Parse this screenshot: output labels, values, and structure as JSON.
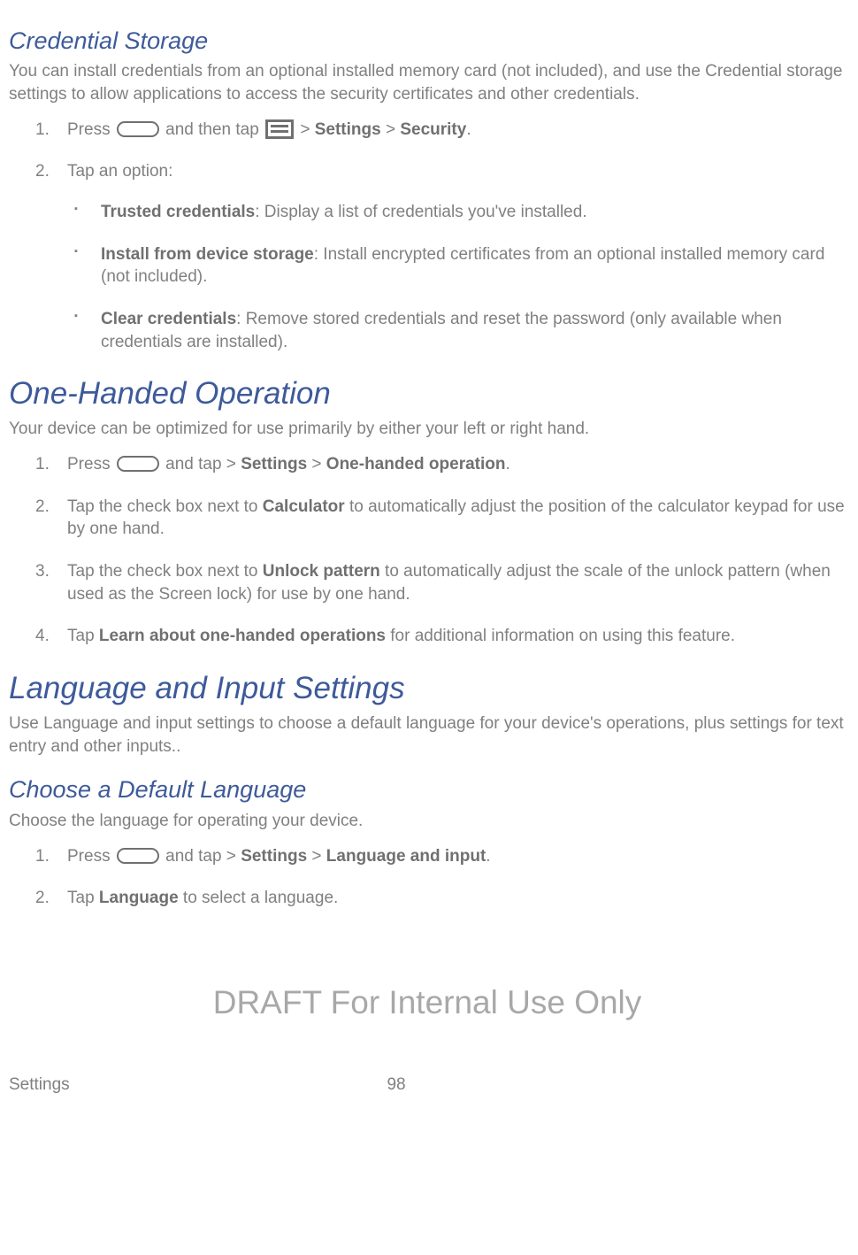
{
  "sec1": {
    "title": "Credential Storage",
    "intro": "You can install credentials from an optional installed memory card (not included), and use the Credential storage settings to allow applications to access the security certificates and other credentials.",
    "step1_a": "Press ",
    "step1_b": " and then tap ",
    "step1_c": " > ",
    "step1_settings": "Settings",
    "step1_d": " > ",
    "step1_security": "Security",
    "step1_e": ".",
    "step2": "Tap an option:",
    "bullet1_b": "Trusted credentials",
    "bullet1_t": ": Display a list of credentials you've installed.",
    "bullet2_b": "Install from device storage",
    "bullet2_t": ": Install encrypted certificates from an optional installed memory card (not included).",
    "bullet3_b": "Clear credentials",
    "bullet3_t": ": Remove stored credentials and reset the password (only available when credentials are installed)."
  },
  "sec2": {
    "title": "One-Handed Operation",
    "intro": "Your device can be optimized for use primarily by either your left or right hand.",
    "step1_a": "Press ",
    "step1_b": " and tap > ",
    "step1_settings": "Settings",
    "step1_c": " > ",
    "step1_oho": "One-handed operation",
    "step1_d": ".",
    "step2_a": "Tap the check box next to ",
    "step2_calc": "Calculator",
    "step2_b": " to automatically adjust the position of the calculator keypad for use by one hand.",
    "step3_a": "Tap the check box next to ",
    "step3_unlock": "Unlock pattern",
    "step3_b": " to automatically adjust the scale of the unlock pattern (when used as the Screen lock) for use by one hand.",
    "step4_a": "Tap ",
    "step4_learn": "Learn about one-handed operations",
    "step4_b": " for additional information on using this feature."
  },
  "sec3": {
    "title": "Language and Input Settings",
    "intro": "Use Language and input settings to choose a default language for your device's operations, plus settings for text entry and other inputs..",
    "sub1_title": "Choose a Default Language",
    "sub1_intro": "Choose the language for operating your device.",
    "step1_a": "Press ",
    "step1_b": " and tap > ",
    "step1_settings": "Settings",
    "step1_c": " > ",
    "step1_lang": "Language and input",
    "step1_d": ".",
    "step2_a": "Tap ",
    "step2_lang": "Language",
    "step2_b": " to select a language."
  },
  "watermark": "DRAFT For Internal Use Only",
  "footer": {
    "section": "Settings",
    "page": "98"
  }
}
